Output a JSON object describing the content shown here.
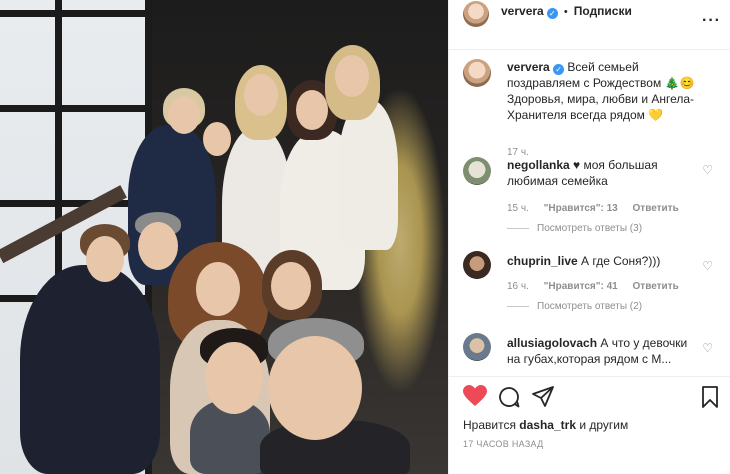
{
  "post": {
    "author": "ververa",
    "follow_label": "Подписки",
    "caption_text": "Всей семьей поздравляем с Рождеством",
    "caption_rest": "Здоровья, мира, любви и Ангела-Хранителя всегда рядом",
    "caption_time": "17 ч."
  },
  "comments": [
    {
      "user": "negollanka",
      "text": "♥ моя большая любимая семейка",
      "time": "15 ч.",
      "likes": "\"Нравится\": 13",
      "reply": "Ответить",
      "view_replies": "Посмотреть ответы (3)"
    },
    {
      "user": "chuprin_live",
      "text": "А где Соня?)))",
      "time": "16 ч.",
      "likes": "\"Нравится\": 41",
      "reply": "Ответить",
      "view_replies": "Посмотреть ответы (2)"
    },
    {
      "user": "allusiagolovach",
      "text": "А что у девочки на губах,которая рядом с М...",
      "time": "",
      "likes": "",
      "reply": "",
      "view_replies": ""
    }
  ],
  "footer": {
    "likes_prefix": "Нравится",
    "likes_user": "dasha_trk",
    "likes_suffix": "и другим",
    "timestamp": "17 ЧАСОВ НАЗАД"
  },
  "icons": {
    "like": "heart-filled-icon",
    "comment": "comment-bubble-icon",
    "share": "paper-plane-icon",
    "save": "bookmark-icon",
    "more": "more-dots-icon",
    "verified": "verified-badge-icon"
  },
  "colors": {
    "accent": "#3897f0",
    "like_red": "#ed4956",
    "muted": "#8e8e8e",
    "text": "#262626"
  }
}
